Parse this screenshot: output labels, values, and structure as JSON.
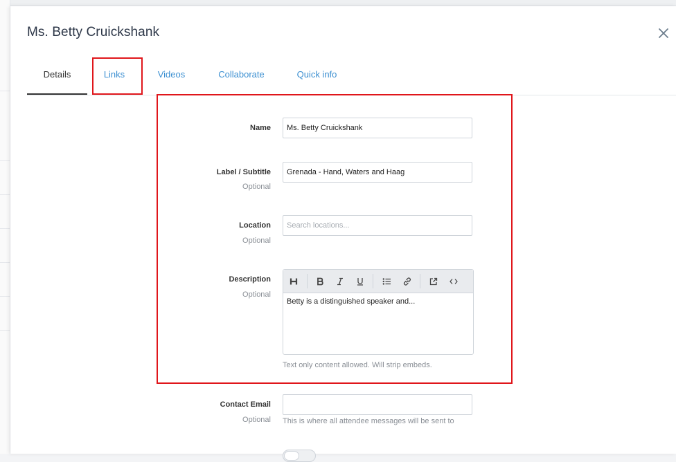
{
  "modal": {
    "title": "Ms. Betty Cruickshank"
  },
  "tabs": [
    {
      "label": "Details",
      "active": true
    },
    {
      "label": "Links",
      "active": false
    },
    {
      "label": "Videos",
      "active": false
    },
    {
      "label": "Collaborate",
      "active": false
    },
    {
      "label": "Quick info",
      "active": false
    }
  ],
  "form": {
    "name": {
      "label": "Name",
      "value": "Ms. Betty Cruickshank"
    },
    "subtitle": {
      "label": "Label / Subtitle",
      "optional": "Optional",
      "value": "Grenada - Hand, Waters and Haag"
    },
    "location": {
      "label": "Location",
      "optional": "Optional",
      "placeholder": "Search locations..."
    },
    "description": {
      "label": "Description",
      "optional": "Optional",
      "value": "Betty is a distinguished speaker and...",
      "hint": "Text only content allowed. Will strip embeds.",
      "toolbar": [
        "heading-icon",
        "bold-icon",
        "italic-icon",
        "underline-icon",
        "bullet-list-icon",
        "link-icon",
        "external-link-icon",
        "code-icon"
      ]
    },
    "contact_email": {
      "label": "Contact Email",
      "optional": "Optional",
      "value": "",
      "hint": "This is where all attendee messages will be sent to"
    }
  },
  "colors": {
    "accent": "#3b8fd1",
    "highlight": "#e0161b",
    "text": "#333333"
  }
}
